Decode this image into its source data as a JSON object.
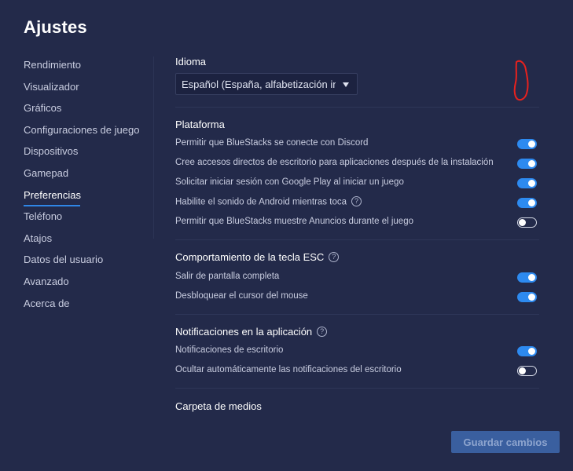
{
  "title": "Ajustes",
  "sidebar": {
    "items": [
      {
        "label": "Rendimiento"
      },
      {
        "label": "Visualizador"
      },
      {
        "label": "Gráficos"
      },
      {
        "label": "Configuraciones de juego"
      },
      {
        "label": "Dispositivos"
      },
      {
        "label": "Gamepad"
      },
      {
        "label": "Preferencias",
        "active": true
      },
      {
        "label": "Teléfono"
      },
      {
        "label": "Atajos"
      },
      {
        "label": "Datos del usuario"
      },
      {
        "label": "Avanzado"
      },
      {
        "label": "Acerca de"
      }
    ]
  },
  "language": {
    "title": "Idioma",
    "selected": "Español (España, alfabetización internacional)"
  },
  "platform": {
    "title": "Plataforma",
    "options": [
      {
        "label": "Permitir que BlueStacks se conecte con Discord",
        "enabled": true
      },
      {
        "label": "Cree accesos directos de escritorio para aplicaciones después de la instalación",
        "enabled": true
      },
      {
        "label": "Solicitar iniciar sesión con Google Play al iniciar un juego",
        "enabled": true
      },
      {
        "label": "Habilite el sonido de Android mientras toca",
        "enabled": true,
        "help": "?"
      },
      {
        "label": "Permitir que BlueStacks muestre Anuncios durante el juego",
        "enabled": false
      }
    ]
  },
  "esc_key": {
    "title": "Comportamiento de la tecla ESC",
    "help": "?",
    "options": [
      {
        "label": "Salir de pantalla completa",
        "enabled": true
      },
      {
        "label": "Desbloquear el cursor del mouse",
        "enabled": true
      }
    ]
  },
  "notifications": {
    "title": "Notificaciones en la aplicación",
    "help": "?",
    "options": [
      {
        "label": "Notificaciones de escritorio",
        "enabled": true
      },
      {
        "label": "Ocultar automáticamente las notificaciones del escritorio",
        "enabled": false
      }
    ]
  },
  "media_folder": {
    "title": "Carpeta de medios"
  },
  "save_label": "Guardar cambios",
  "colors": {
    "background": "#232a4a",
    "accent": "#2d8af0",
    "annotation": "#e8211d"
  }
}
